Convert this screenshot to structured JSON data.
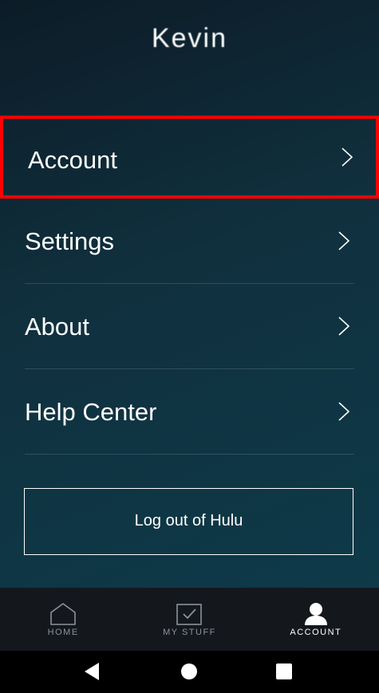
{
  "profile": {
    "name": "Kevin"
  },
  "menu": {
    "items": [
      {
        "label": "Account"
      },
      {
        "label": "Settings"
      },
      {
        "label": "About"
      },
      {
        "label": "Help Center"
      }
    ],
    "logout_label": "Log out of Hulu"
  },
  "tabbar": {
    "tabs": [
      {
        "label": "HOME",
        "icon": "home-icon",
        "active": false
      },
      {
        "label": "MY STUFF",
        "icon": "checkbox-icon",
        "active": false
      },
      {
        "label": "ACCOUNT",
        "icon": "person-icon",
        "active": true
      }
    ]
  },
  "system_nav": {
    "buttons": [
      "back-icon",
      "home-circle-icon",
      "recents-square-icon"
    ]
  },
  "colors": {
    "highlight": "#ff0000",
    "text": "#ffffff",
    "tab_inactive": "#8c9299",
    "tabbar_bg": "#14181d"
  }
}
